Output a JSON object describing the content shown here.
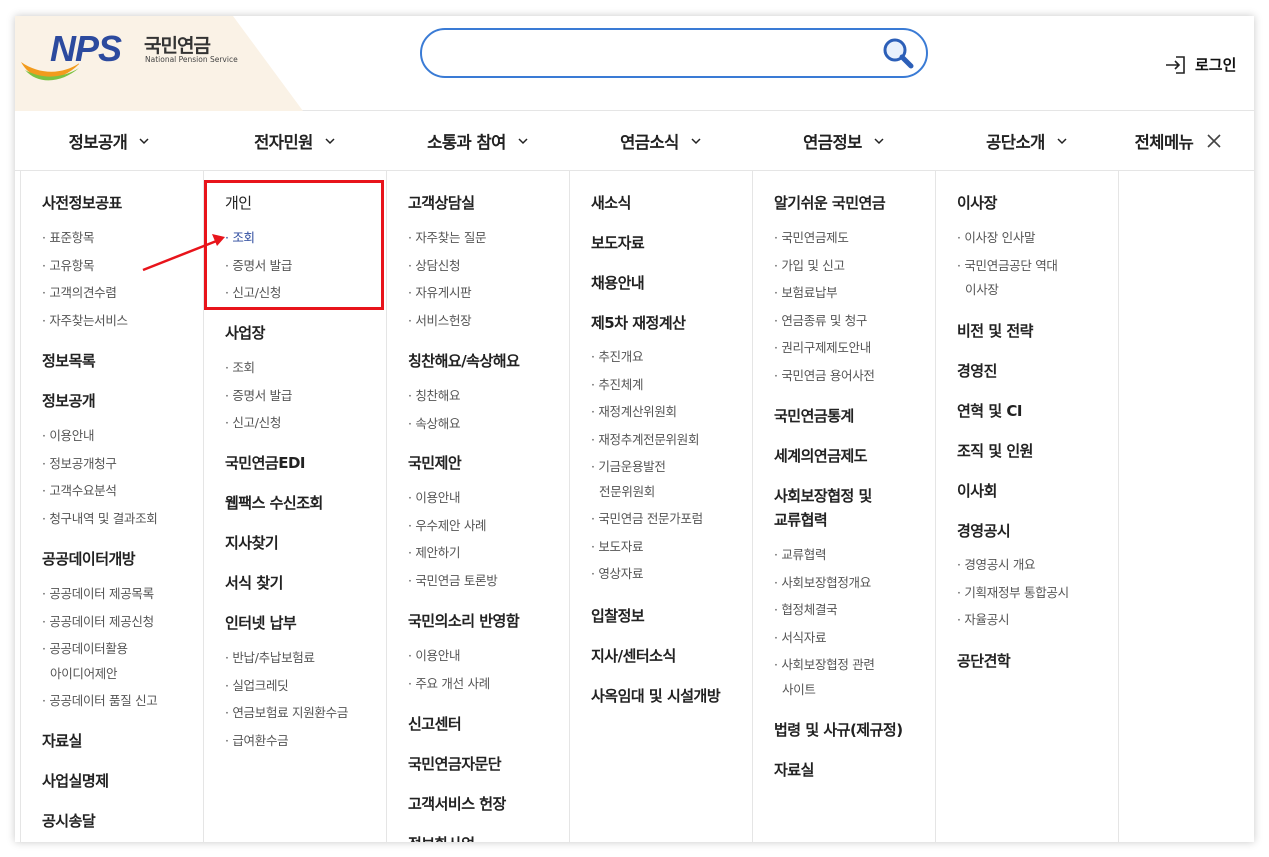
{
  "header": {
    "logo_text": "NPS",
    "logo_korean": "국민연금",
    "logo_english": "National Pension Service",
    "search_placeholder": "",
    "login_label": "로그인"
  },
  "nav": {
    "items": [
      "정보공개",
      "전자민원",
      "소통과 참여",
      "연금소식",
      "연금정보",
      "공단소개"
    ],
    "all_menu_label": "전체메뉴"
  },
  "columns": {
    "c1": {
      "h1": "사전정보공표",
      "s1": [
        "표준항목",
        "고유항목",
        "고객의견수렴",
        "자주찾는서비스"
      ],
      "h2": "정보목록",
      "h3": "정보공개",
      "s3": [
        "이용안내",
        "정보공개청구",
        "고객수요분석",
        "청구내역 및 결과조회"
      ],
      "h4": "공공데이터개방",
      "s4": [
        "공공데이터 제공목록",
        "공공데이터 제공신청",
        "공공데이터활용",
        "아이디어제안",
        "공공데이터 품질 신고"
      ],
      "h5": "자료실",
      "h6": "사업실명제",
      "h7": "공시송달"
    },
    "c2": {
      "h1": "개인",
      "s1": [
        "조회",
        "증명서 발급",
        "신고/신청"
      ],
      "h2": "사업장",
      "s2": [
        "조회",
        "증명서 발급",
        "신고/신청"
      ],
      "h3": "국민연금EDI",
      "h4": "웹팩스 수신조회",
      "h5": "지사찾기",
      "h6": "서식 찾기",
      "h7": "인터넷 납부",
      "s7": [
        "반납/추납보험료",
        "실업크레딧",
        "연금보험료 지원환수금",
        "급여환수금"
      ]
    },
    "c3": {
      "h1": "고객상담실",
      "s1": [
        "자주찾는 질문",
        "상담신청",
        "자유게시판",
        "서비스헌장"
      ],
      "h2": "칭찬해요/속상해요",
      "s2": [
        "칭찬해요",
        "속상해요"
      ],
      "h3": "국민제안",
      "s3": [
        "이용안내",
        "우수제안 사례",
        "제안하기",
        "국민연금 토론방"
      ],
      "h4": "국민의소리 반영함",
      "s4": [
        "이용안내",
        "주요 개선 사례"
      ],
      "h5": "신고센터",
      "h6": "국민연금자문단",
      "h7": "고객서비스 헌장",
      "h8": "정보화사업"
    },
    "c4": {
      "h1": "새소식",
      "h2": "보도자료",
      "h3": "채용안내",
      "h4": "제5차 재정계산",
      "s4": [
        "추진개요",
        "추진체계",
        "재정계산위원회",
        "재정추계전문위원회",
        "기금운용발전",
        "전문위원회",
        "국민연금 전문가포럼",
        "보도자료",
        "영상자료"
      ],
      "h5": "입찰정보",
      "h6": "지사/센터소식",
      "h7": "사옥임대 및 시설개방"
    },
    "c5": {
      "h1": "알기쉬운 국민연금",
      "s1": [
        "국민연금제도",
        "가입 및 신고",
        "보험료납부",
        "연금종류 및 청구",
        "권리구제제도안내",
        "국민연금 용어사전"
      ],
      "h2": "국민연금통계",
      "h3": "세계의연금제도",
      "h4a": "사회보장협정 및",
      "h4b": "교류협력",
      "s4": [
        "교류협력",
        "사회보장협정개요",
        "협정체결국",
        "서식자료",
        "사회보장협정 관련",
        "사이트"
      ],
      "h5": "법령 및 사규(제규정)",
      "h6": "자료실"
    },
    "c6": {
      "h1": "이사장",
      "s1": [
        "이사장 인사말",
        "국민연금공단 역대",
        "이사장"
      ],
      "h2": "비전 및 전략",
      "h3": "경영진",
      "h4": "연혁 및 CI",
      "h5": "조직 및 인원",
      "h6": "이사회",
      "h7": "경영공시",
      "s7": [
        "경영공시 개요",
        "기획재정부 통합공시",
        "자율공시"
      ],
      "h8": "공단견학"
    }
  },
  "colors": {
    "brand_blue": "#2c4a9e",
    "highlight_red": "#e8141b",
    "search_border": "#3a7bd5"
  }
}
